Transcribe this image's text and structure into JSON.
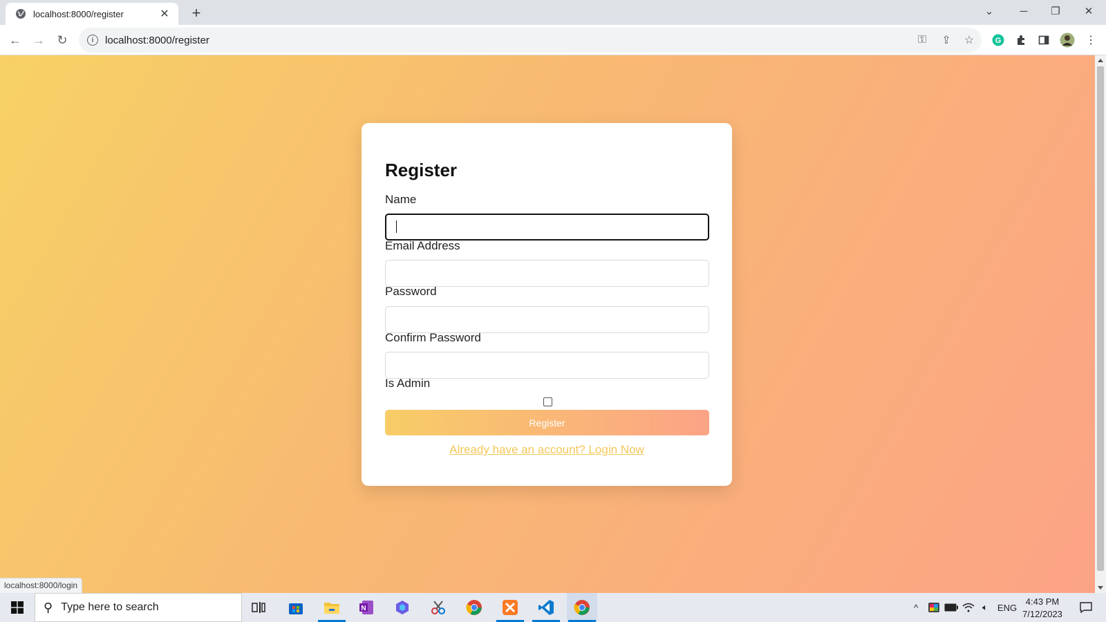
{
  "browser": {
    "tab_title": "localhost:8000/register",
    "url": "localhost:8000/register",
    "status_url": "localhost:8000/login"
  },
  "form": {
    "title": "Register",
    "name_label": "Name",
    "name_value": "",
    "email_label": "Email Address",
    "email_value": "",
    "password_label": "Password",
    "password_value": "",
    "confirm_label": "Confirm Password",
    "confirm_value": "",
    "admin_label": "Is Admin",
    "admin_checked": false,
    "submit_label": "Register",
    "login_link": "Already have an account? Login Now"
  },
  "colors": {
    "gradient_start": "#f7d165",
    "gradient_end": "#fca386",
    "link": "#f5c75a"
  },
  "taskbar": {
    "search_placeholder": "Type here to search",
    "language": "ENG",
    "time": "4:43 PM",
    "date": "7/12/2023",
    "apps": [
      "task-view",
      "microsoft-store",
      "file-explorer",
      "onenote",
      "copilot",
      "snipping-tool",
      "chrome",
      "xampp",
      "vscode",
      "chrome-active"
    ]
  }
}
